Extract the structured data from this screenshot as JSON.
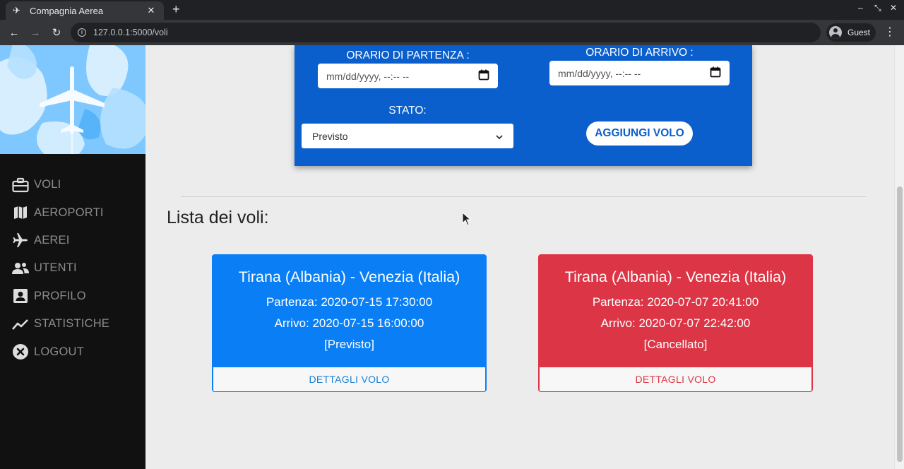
{
  "browser": {
    "tab_title": "Compagnia Aerea",
    "url": "127.0.0.1:5000/voli",
    "profile_label": "Guest"
  },
  "sidebar": {
    "items": [
      {
        "label": "VOLI",
        "icon": "briefcase-icon"
      },
      {
        "label": "AEROPORTI",
        "icon": "map-icon"
      },
      {
        "label": "AEREI",
        "icon": "plane-icon"
      },
      {
        "label": "UTENTI",
        "icon": "users-icon"
      },
      {
        "label": "PROFILO",
        "icon": "profile-card-icon"
      },
      {
        "label": "STATISTICHE",
        "icon": "chart-line-icon"
      },
      {
        "label": "LOGOUT",
        "icon": "logout-icon"
      }
    ]
  },
  "form": {
    "departure_label": "ORARIO DI PARTENZA :",
    "departure_placeholder": "mm/dd/yyyy, --:-- --",
    "arrival_label": "ORARIO DI ARRIVO :",
    "arrival_placeholder": "mm/dd/yyyy, --:-- --",
    "status_label": "STATO:",
    "status_value": "Previsto",
    "add_button": "AGGIUNGI VOLO"
  },
  "list": {
    "title": "Lista dei voli:",
    "flights": [
      {
        "route": "Tirana (Albania) - Venezia (Italia)",
        "departure": "Partenza: 2020-07-15 17:30:00",
        "arrival": "Arrivo: 2020-07-15 16:00:00",
        "status": "[Previsto]",
        "button": "DETTAGLI VOLO",
        "color": "#0a7ff5"
      },
      {
        "route": "Tirana (Albania) - Venezia (Italia)",
        "departure": "Partenza: 2020-07-07 20:41:00",
        "arrival": "Arrivo: 2020-07-07 22:42:00",
        "status": "[Cancellato]",
        "button": "DETTAGLI VOLO",
        "color": "#dc3545"
      }
    ]
  },
  "colors": {
    "form_bg": "#0a5fcc",
    "sidebar_bg": "#111111",
    "page_bg": "#ececec"
  }
}
